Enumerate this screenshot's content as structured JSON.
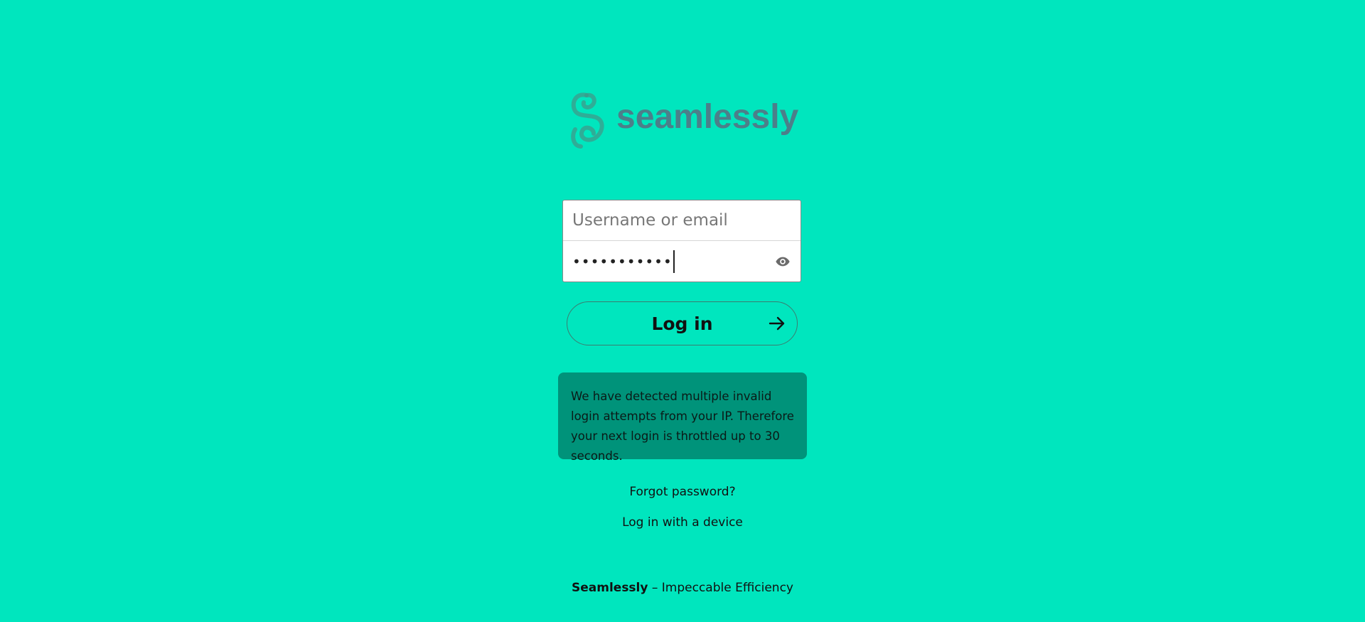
{
  "brand": {
    "logo_text": "seamlessly",
    "logo_color": "#4c7f8a",
    "logo_icon": "seamlessly-swirl-icon"
  },
  "login_form": {
    "username_placeholder": "Username or email",
    "username_value": "",
    "password_masked": "•••••••••••",
    "password_toggle_icon": "eye-icon"
  },
  "login_button": {
    "label": "Log in",
    "icon": "arrow-right-icon"
  },
  "warning": {
    "text": "We have detected multiple invalid login attempts from your IP. Therefore your next login is throttled up to 30 seconds."
  },
  "links": {
    "forgot_password": "Forgot password?",
    "device_login": "Log in with a device"
  },
  "footer": {
    "name": "Seamlessly",
    "separator": " – ",
    "slogan": "Impeccable Efficiency"
  },
  "colors": {
    "background": "#00e6be",
    "warning_background": "#00937a",
    "button_border": "#3c7c70"
  }
}
